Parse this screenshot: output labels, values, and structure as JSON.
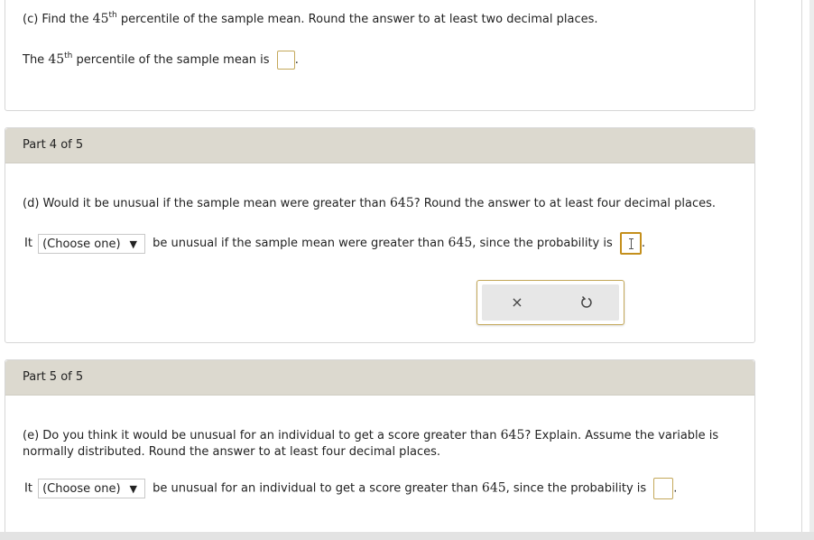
{
  "part3": {
    "question_prefix": "(c) Find the ",
    "question_num": "45",
    "question_sup": "th",
    "question_suffix": " percentile of the sample mean. Round the answer to at least two decimal places.",
    "answer_prefix": "The ",
    "answer_num": "45",
    "answer_sup": "th",
    "answer_suffix": " percentile of the sample mean is",
    "answer_end": "."
  },
  "part4": {
    "header": "Part 4 of 5",
    "question_prefix": "(d) Would it be unusual if the sample mean were greater than ",
    "question_num": "645",
    "question_suffix": "? Round the answer to at least four decimal places.",
    "answer_it": "It",
    "select_value": "(Choose one)",
    "answer_mid": "be unusual if the sample mean were greater than ",
    "answer_num": "645",
    "answer_suffix": ", since the probability is",
    "answer_end": "."
  },
  "tools": {
    "clear_icon": "×",
    "undo_icon": "↺"
  },
  "part5": {
    "header": "Part 5 of 5",
    "question_line1_prefix": "(e) Do you think it would be unusual for an individual to get a score greater than ",
    "question_num": "645",
    "question_line1_suffix": "? Explain. Assume the variable is",
    "question_line2": "normally distributed. Round the answer to at least four decimal places.",
    "answer_it": "It",
    "select_value": "(Choose one)",
    "answer_mid": "be unusual for an individual to get a score greater than ",
    "answer_num": "645",
    "answer_suffix": ", since the probability is",
    "answer_end": "."
  }
}
